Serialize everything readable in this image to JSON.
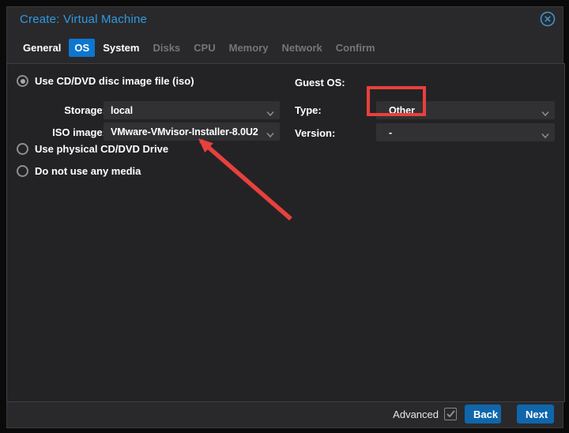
{
  "dialog": {
    "title": "Create: Virtual Machine"
  },
  "tabs": [
    {
      "label": "General",
      "state": "enabled"
    },
    {
      "label": "OS",
      "state": "active"
    },
    {
      "label": "System",
      "state": "enabled"
    },
    {
      "label": "Disks",
      "state": "disabled"
    },
    {
      "label": "CPU",
      "state": "disabled"
    },
    {
      "label": "Memory",
      "state": "disabled"
    },
    {
      "label": "Network",
      "state": "disabled"
    },
    {
      "label": "Confirm",
      "state": "disabled"
    }
  ],
  "form": {
    "left": {
      "radio_iso": {
        "label": "Use CD/DVD disc image file (iso)",
        "selected": true
      },
      "storage": {
        "label": "Storage:",
        "value": "local"
      },
      "iso_image": {
        "label": "ISO image:",
        "value": "VMware-VMvisor-Installer-8.0U2"
      },
      "radio_physical": {
        "label": "Use physical CD/DVD Drive",
        "selected": false
      },
      "radio_none": {
        "label": "Do not use any media",
        "selected": false
      }
    },
    "right": {
      "heading": "Guest OS:",
      "type": {
        "label": "Type:",
        "value": "Other"
      },
      "version": {
        "label": "Version:",
        "value": "-"
      }
    }
  },
  "footer": {
    "advanced_label": "Advanced",
    "advanced_checked": true,
    "back_label": "Back",
    "next_label": "Next"
  },
  "annotations": {
    "color": "#e8403d",
    "box_target": "guest-os-type-value",
    "arrow_target": "iso-image-field"
  },
  "colors": {
    "title_blue": "#2e9be2",
    "active_tab_blue": "#0e76cf",
    "button_blue": "#0f66ab",
    "panel_bg": "#232325",
    "dialog_bg": "#29292b",
    "field_bg": "#313134",
    "annotation_red": "#e8403d"
  }
}
